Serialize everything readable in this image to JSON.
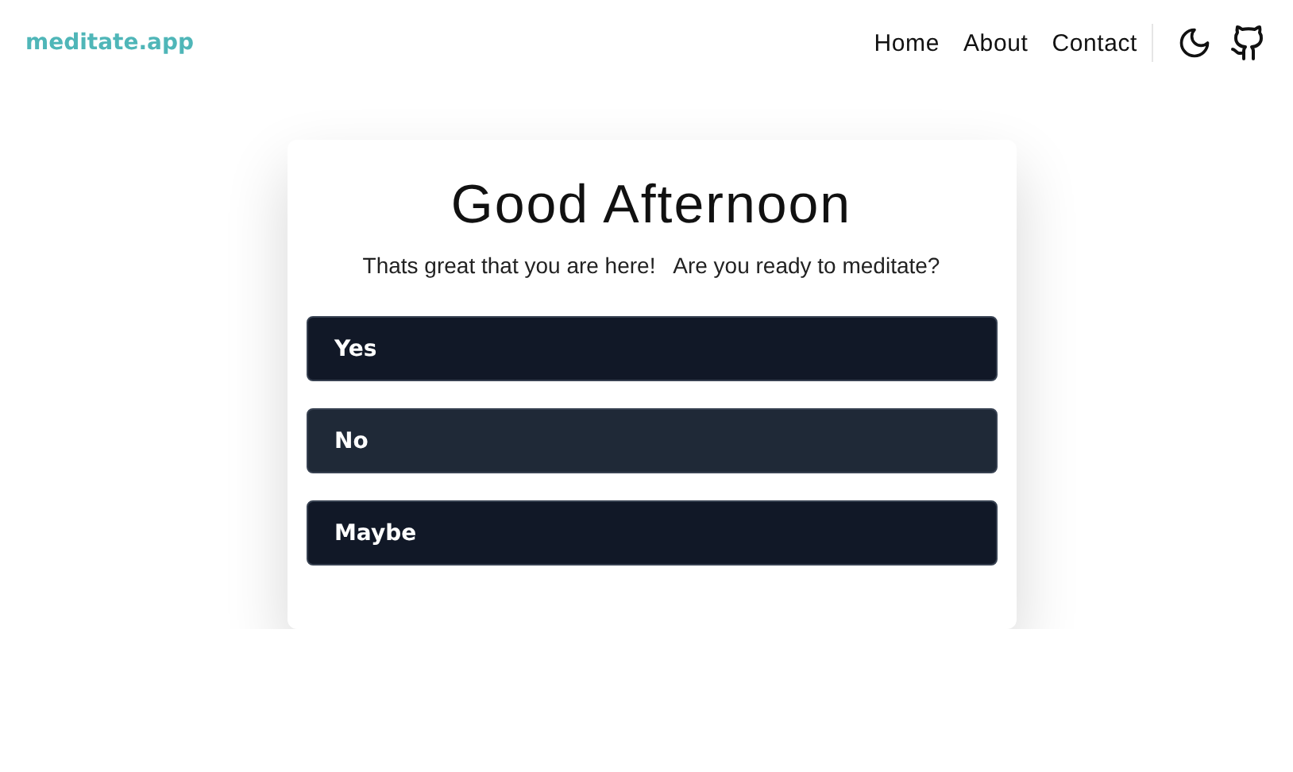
{
  "nav": {
    "logo": "meditate.app",
    "links": [
      "Home",
      "About",
      "Contact"
    ]
  },
  "card": {
    "title": "Good Afternoon",
    "subtitle": "Thats great that you are here!   Are you ready to meditate?",
    "options": [
      {
        "label": "Yes",
        "selected": false
      },
      {
        "label": "No",
        "selected": true
      },
      {
        "label": "Maybe",
        "selected": false
      }
    ]
  }
}
